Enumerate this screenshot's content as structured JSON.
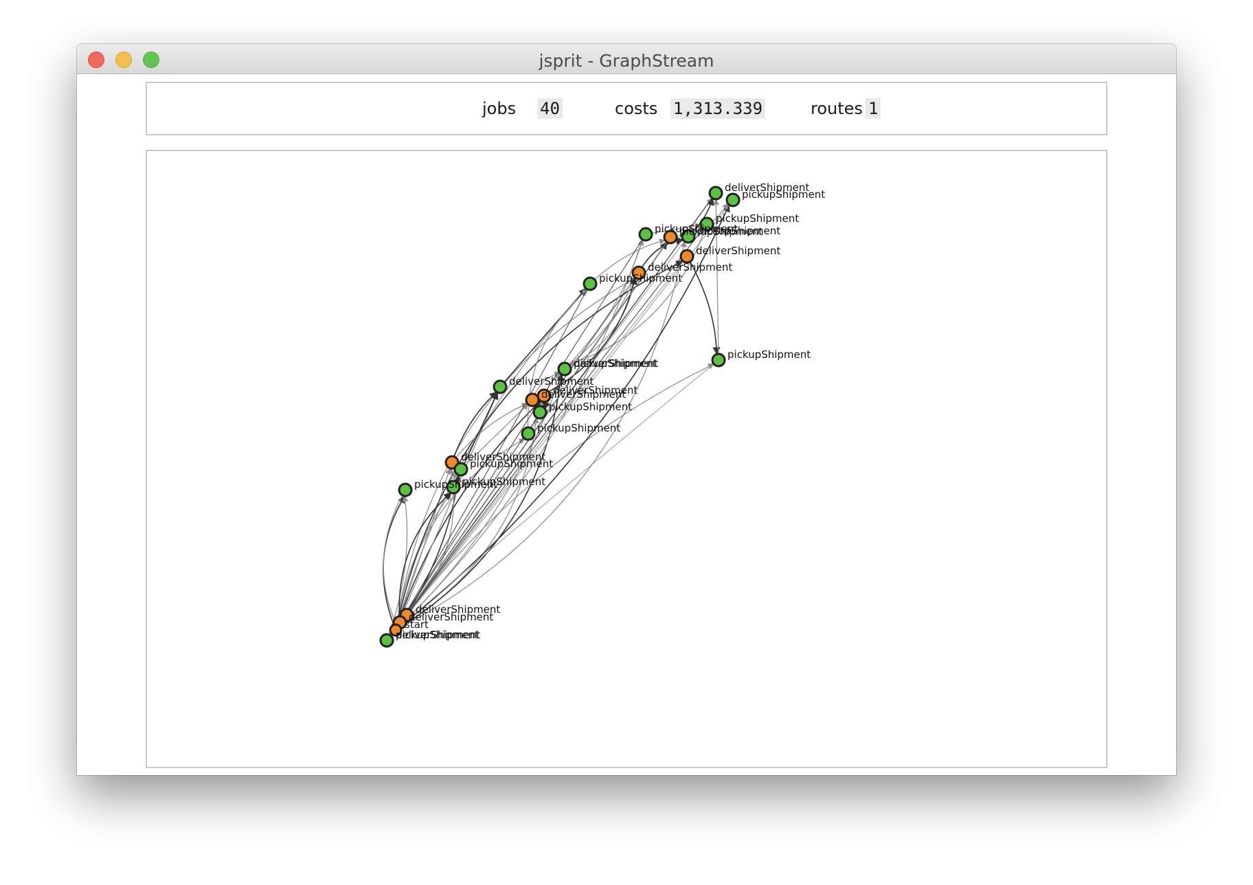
{
  "window": {
    "title": "jsprit - GraphStream"
  },
  "stats": {
    "jobs_label": "jobs",
    "jobs_value": "40",
    "costs_label": "costs",
    "costs_value": "1,313.339",
    "routes_label": "routes",
    "routes_value": "1"
  },
  "colors": {
    "pickup_node": "#5cc242",
    "deliver_node": "#f08a2a",
    "depot": "#d8301e",
    "edge_dark": "#333333",
    "edge_light": "#909090"
  },
  "labels": {
    "start": "start",
    "pickup": "pickupShipment",
    "deliver": "deliverShipment"
  },
  "graph": {
    "nodes": [
      {
        "id": "p1",
        "type": "pickup",
        "label": "pickupShipment"
      },
      {
        "id": "p2",
        "type": "pickup",
        "label": "deliverShipment"
      },
      {
        "id": "d1",
        "type": "deliver",
        "label": "deliverShipment"
      },
      {
        "id": "d2",
        "type": "deliver",
        "label": "deliverShipment"
      },
      {
        "id": "s1",
        "type": "start",
        "label": "start"
      },
      {
        "id": "p3",
        "type": "pickup",
        "label": "pickupShipment"
      },
      {
        "id": "p4",
        "type": "pickup",
        "label": "pickupShipment"
      },
      {
        "id": "d3",
        "type": "deliver",
        "label": "deliverShipment"
      },
      {
        "id": "p5",
        "type": "pickup",
        "label": "pickupShipment"
      },
      {
        "id": "p6",
        "type": "pickup",
        "label": "deliverShipment"
      },
      {
        "id": "p7",
        "type": "pickup",
        "label": "pickupShipment"
      },
      {
        "id": "p8",
        "type": "pickup",
        "label": "pickupShipment"
      },
      {
        "id": "d4",
        "type": "deliver",
        "label": "deliverShipment"
      },
      {
        "id": "d5",
        "type": "deliver",
        "label": "deliverShipment"
      },
      {
        "id": "p9",
        "type": "pickup",
        "label": "pickupShipment"
      },
      {
        "id": "p10",
        "type": "pickup",
        "label": "deliverShipment"
      },
      {
        "id": "p11",
        "type": "pickup",
        "label": "pickupShipment"
      },
      {
        "id": "p12",
        "type": "pickup",
        "label": "pickupShipment"
      },
      {
        "id": "d6",
        "type": "deliver",
        "label": "deliverShipment"
      },
      {
        "id": "d7",
        "type": "deliver",
        "label": "pickupShipment"
      },
      {
        "id": "p13",
        "type": "pickup",
        "label": "pickupShipment"
      },
      {
        "id": "p14",
        "type": "pickup",
        "label": "pickupShipment"
      },
      {
        "id": "d8",
        "type": "deliver",
        "label": "deliverShipment"
      },
      {
        "id": "p15",
        "type": "pickup",
        "label": "pickupShipment"
      },
      {
        "id": "p16",
        "type": "pickup",
        "label": "deliverShipment"
      },
      {
        "id": "p17",
        "type": "pickup",
        "label": "pickupShipment"
      }
    ],
    "edges": [
      [
        "s1",
        "p3"
      ],
      [
        "s1",
        "p4"
      ],
      [
        "s1",
        "d3"
      ],
      [
        "s1",
        "p5"
      ],
      [
        "s1",
        "p8"
      ],
      [
        "s1",
        "p7"
      ],
      [
        "s1",
        "d5"
      ],
      [
        "s1",
        "p6"
      ],
      [
        "s1",
        "p10"
      ],
      [
        "s1",
        "p9"
      ],
      [
        "s1",
        "d6"
      ],
      [
        "s1",
        "p11"
      ],
      [
        "s1",
        "d7"
      ],
      [
        "s1",
        "p12"
      ],
      [
        "s1",
        "p13"
      ],
      [
        "s1",
        "d8"
      ],
      [
        "s1",
        "p15"
      ],
      [
        "s1",
        "p16"
      ],
      [
        "s1",
        "p17"
      ],
      [
        "p3",
        "s1"
      ],
      [
        "p4",
        "p5"
      ],
      [
        "d3",
        "p6"
      ],
      [
        "p5",
        "d4"
      ],
      [
        "p7",
        "d5"
      ],
      [
        "p8",
        "d5"
      ],
      [
        "d4",
        "p10"
      ],
      [
        "d5",
        "p9"
      ],
      [
        "p6",
        "p11"
      ],
      [
        "p9",
        "d6"
      ],
      [
        "p10",
        "d6"
      ],
      [
        "d6",
        "p13"
      ],
      [
        "p11",
        "d7"
      ],
      [
        "p12",
        "p14"
      ],
      [
        "p13",
        "p16"
      ],
      [
        "d7",
        "p17"
      ],
      [
        "p14",
        "p10"
      ],
      [
        "d8",
        "p15"
      ],
      [
        "p15",
        "p16"
      ],
      [
        "p9",
        "p12"
      ],
      [
        "d4",
        "d6"
      ],
      [
        "p7",
        "p11"
      ],
      [
        "d3",
        "d4"
      ],
      [
        "p4",
        "p6"
      ],
      [
        "p1",
        "p3"
      ],
      [
        "d1",
        "d3"
      ],
      [
        "d2",
        "p4"
      ]
    ]
  }
}
